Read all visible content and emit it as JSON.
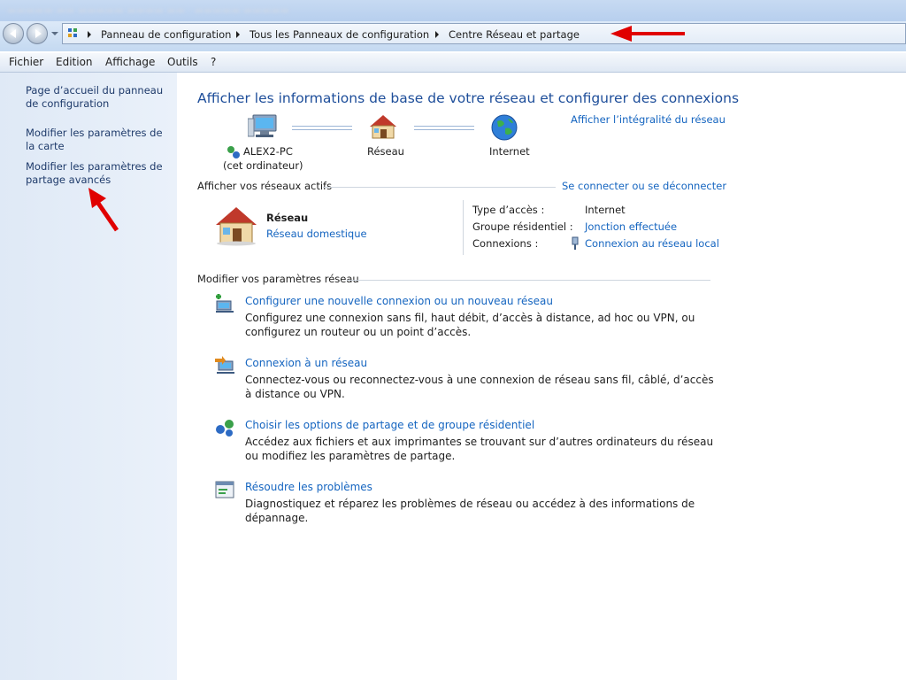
{
  "address_bar": {
    "crumbs": [
      "Panneau de configuration",
      "Tous les Panneaux de configuration",
      "Centre Réseau et partage"
    ]
  },
  "menu": [
    "Fichier",
    "Edition",
    "Affichage",
    "Outils",
    "?"
  ],
  "left_pane": {
    "links": [
      "Page d’accueil du panneau de configuration",
      "Modifier les paramètres de la carte",
      "Modifier les paramètres de partage avancés"
    ]
  },
  "main": {
    "title": "Afficher les informations de base de votre réseau et configurer des connexions",
    "full_map_link": "Afficher l’intégralité du réseau",
    "map": {
      "computer_name": "ALEX2-PC",
      "computer_sub": "(cet ordinateur)",
      "network_label": "Réseau",
      "internet_label": "Internet"
    },
    "active_networks": {
      "heading": "Afficher vos réseaux actifs",
      "connect_link": "Se connecter ou se déconnecter",
      "network_name": "Réseau",
      "network_type": "Réseau domestique",
      "access_type_label": "Type d’accès :",
      "access_type_value": "Internet",
      "homegroup_label": "Groupe résidentiel :",
      "homegroup_value": "Jonction effectuée",
      "connections_label": "Connexions :",
      "connections_value": "Connexion au réseau local"
    },
    "settings": {
      "heading": "Modifier vos paramètres réseau",
      "tasks": [
        {
          "title": "Configurer une nouvelle connexion ou un nouveau réseau",
          "desc": "Configurez une connexion sans fil, haut débit, d’accès à distance, ad hoc ou VPN, ou configurez un routeur ou un point d’accès.",
          "icon": "new-connection-icon"
        },
        {
          "title": "Connexion à un réseau",
          "desc": "Connectez-vous ou reconnectez-vous à une connexion de réseau sans fil, câblé, d’accès à distance ou VPN.",
          "icon": "connect-network-icon"
        },
        {
          "title": "Choisir les options de partage et de groupe résidentiel",
          "desc": "Accédez aux fichiers et aux imprimantes se trouvant sur d’autres ordinateurs du réseau ou modifiez les paramètres de partage.",
          "icon": "sharing-options-icon"
        },
        {
          "title": "Résoudre les problèmes",
          "desc": "Diagnostiquez et réparez les problèmes de réseau ou accédez à des informations de dépannage.",
          "icon": "troubleshoot-icon"
        }
      ]
    }
  },
  "colors": {
    "link": "#1565c0",
    "title": "#1e4e9a",
    "left_pane": "#dfe9f6",
    "annotation_arrow": "#e00000"
  }
}
